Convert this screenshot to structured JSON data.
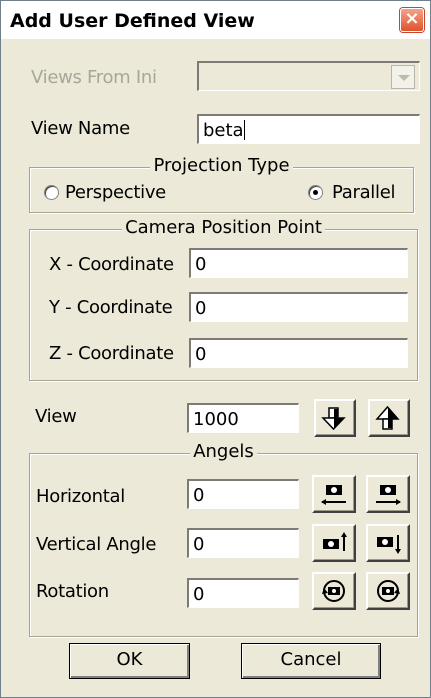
{
  "window": {
    "title": "Add User Defined View",
    "close_glyph": "×"
  },
  "views_from_ini": {
    "label": "Views From Ini",
    "value": "",
    "icon": "chevron-down-icon"
  },
  "view_name": {
    "label": "View Name",
    "value": "beta"
  },
  "projection_type": {
    "legend": "Projection Type",
    "perspective_label": "Perspective",
    "parallel_label": "Parallel",
    "selected": "Parallel"
  },
  "camera_position": {
    "legend": "Camera Position Point",
    "x_label": "X - Coordinate",
    "x_value": "0",
    "y_label": "Y - Coordinate",
    "y_value": "0",
    "z_label": "Z - Coordinate",
    "z_value": "0"
  },
  "view": {
    "label": "View",
    "value": "1000",
    "icons": [
      "arrow-down-icon",
      "arrow-up-icon"
    ]
  },
  "angels": {
    "legend": "Angels",
    "horizontal_label": "Horizontal",
    "horizontal_value": "0",
    "vertical_label": "Vertical Angle",
    "vertical_value": "0",
    "rotation_label": "Rotation",
    "rotation_value": "0",
    "icons": [
      "camera-left-icon",
      "camera-right-icon",
      "camera-up-icon",
      "camera-down-icon",
      "camera-rotate-ccw-icon",
      "camera-rotate-cw-icon"
    ]
  },
  "buttons": {
    "ok": "OK",
    "cancel": "Cancel"
  },
  "colors": {
    "dialog_bg": "#ece9d8",
    "close_red": "#e0532b",
    "disabled_text": "#a7a69a"
  }
}
